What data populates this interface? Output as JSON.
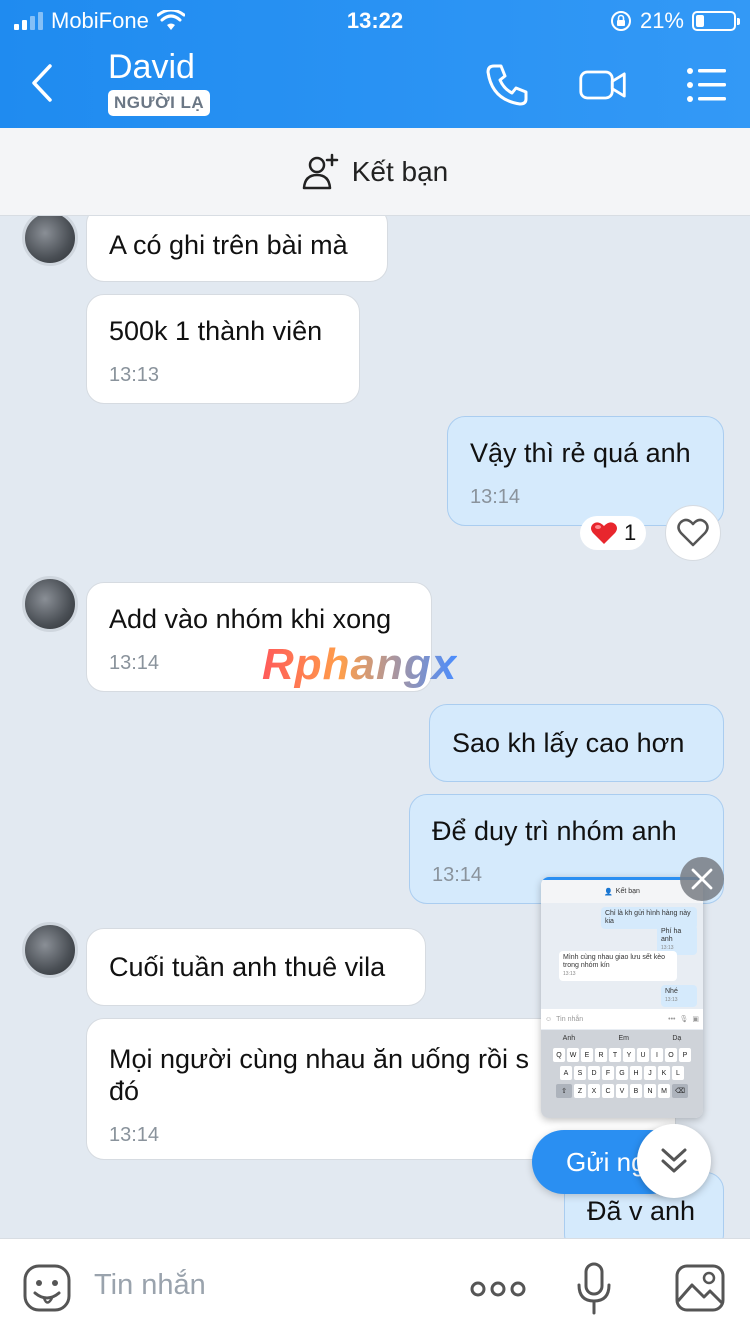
{
  "status_bar": {
    "carrier": "MobiFone",
    "time": "13:22",
    "battery": "21%",
    "battery_level": 0.21
  },
  "header": {
    "contact_name": "David",
    "badge": "NGƯỜI LẠ",
    "icons": [
      "back-icon",
      "phone-icon",
      "video-icon",
      "menu-icon"
    ]
  },
  "friend_bar": {
    "label": "Kết bạn"
  },
  "messages": [
    {
      "side": "in",
      "text": "A có ghi trên bài mà",
      "time": ""
    },
    {
      "side": "in",
      "text": "500k 1 thành viên",
      "time": "13:13"
    },
    {
      "side": "out",
      "text": "Vậy thì rẻ quá anh",
      "time": "13:14",
      "reaction": {
        "emoji": "❤️",
        "count": "1"
      }
    },
    {
      "side": "in",
      "text": "Add vào nhóm khi xong",
      "time": "13:14"
    },
    {
      "side": "out",
      "text": "Sao kh lấy cao hơn",
      "time": ""
    },
    {
      "side": "out",
      "text": "Để duy trì nhóm anh",
      "time": "13:14"
    },
    {
      "side": "in",
      "text": "Cuối tuần anh thuê vila",
      "time": ""
    },
    {
      "side": "in",
      "text": "Mọi người cùng nhau ăn uống rồi s",
      "text2": "đó",
      "time": "13:14"
    },
    {
      "side": "out",
      "text": "Đã v anh",
      "time": ""
    }
  ],
  "watermark": "Rphangx",
  "mini_window": {
    "title": "Kết bạn",
    "msg1": "Chỉ là kh gửi hình hàng này kia",
    "msg2": "Phí ha anh",
    "msg2_time": "13:13",
    "msg3": "Mình cùng nhau giao lưu sết kèo trong nhóm kín",
    "msg3_time": "13:13",
    "msg4": "Nhé",
    "msg4_time": "13:13",
    "input_placeholder": "Tin nhắn",
    "suggestions": [
      "Anh",
      "Em",
      "Dạ"
    ],
    "keys_row1": [
      "Q",
      "W",
      "E",
      "R",
      "T",
      "Y",
      "U",
      "I",
      "O",
      "P"
    ],
    "keys_row2": [
      "A",
      "S",
      "D",
      "F",
      "G",
      "H",
      "J",
      "K",
      "L"
    ],
    "keys_row3": [
      "Z",
      "X",
      "C",
      "V",
      "B",
      "N",
      "M"
    ]
  },
  "send_now": "Gửi ng",
  "composer": {
    "placeholder": "Tin nhắn"
  },
  "colors": {
    "header": "#1f8bf0",
    "outgoing_bubble": "#d5eafc",
    "incoming_bubble": "#ffffff",
    "chat_bg": "#e2e9f1"
  }
}
